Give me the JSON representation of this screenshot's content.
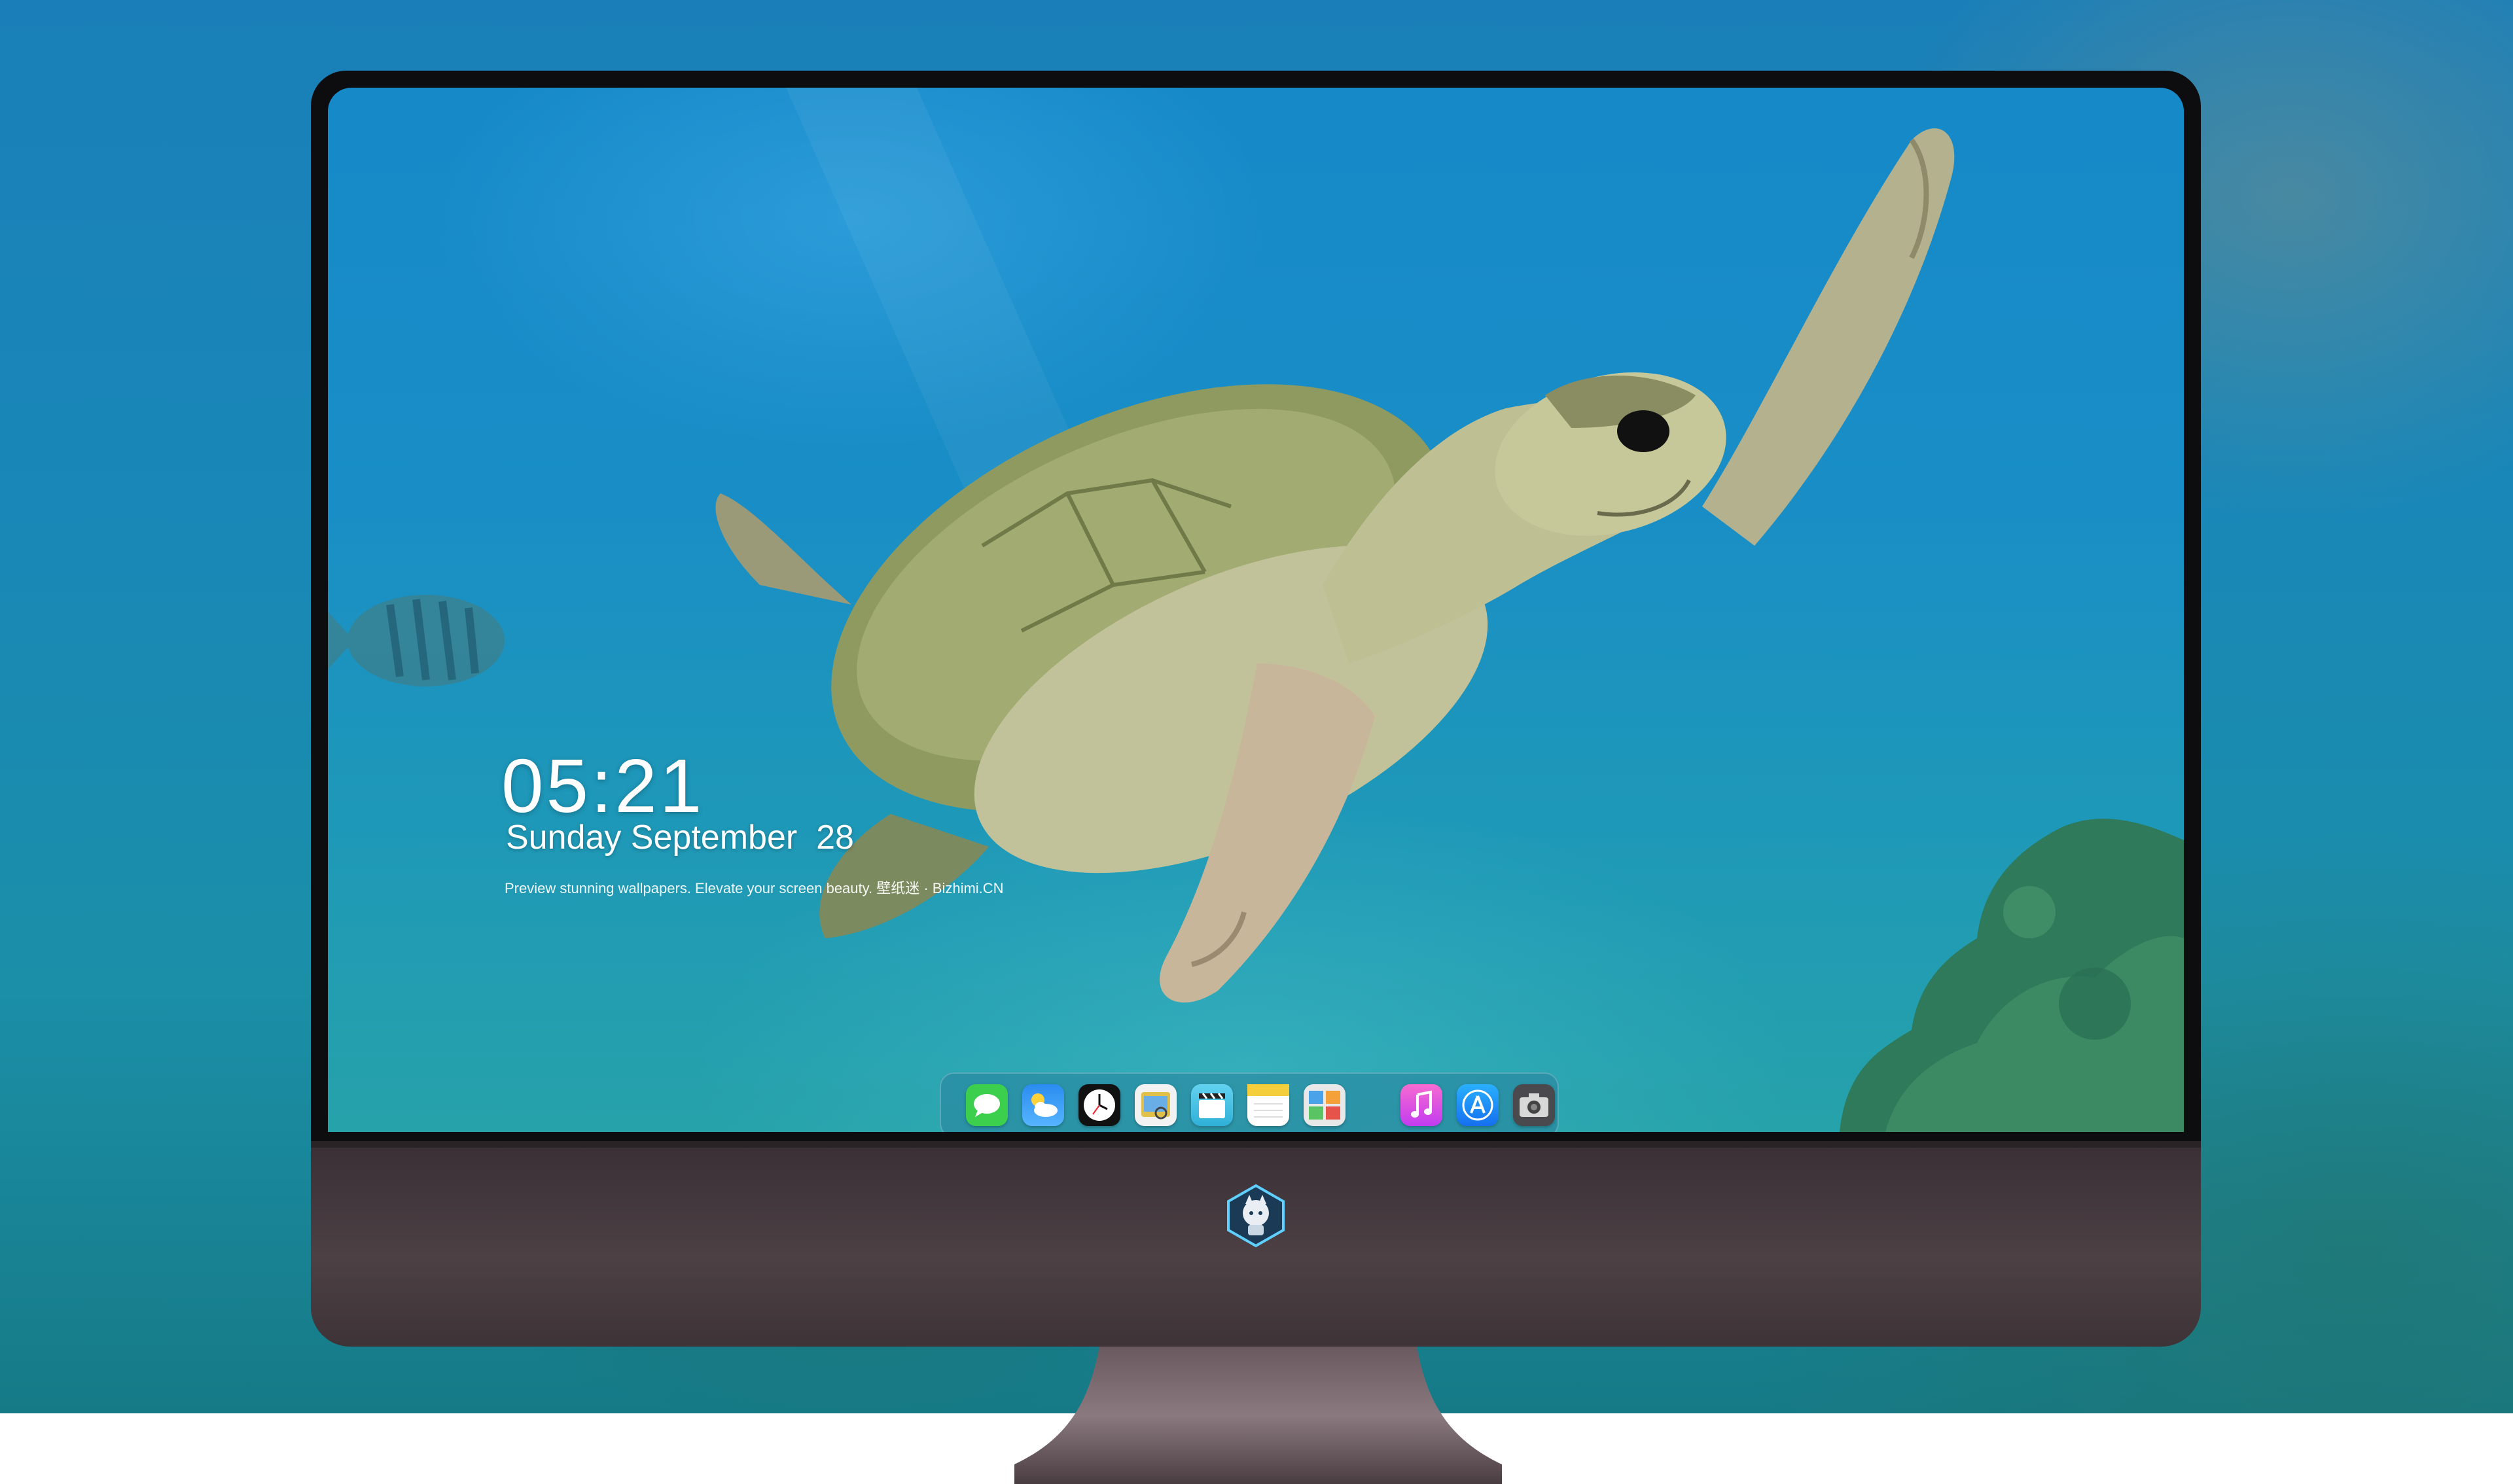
{
  "lockscreen": {
    "time": "05:21",
    "date": "Sunday September  28",
    "tagline": "Preview stunning wallpapers. Elevate your screen beauty. 壁纸迷 · Bizhimi.CN"
  },
  "dock": {
    "apps": [
      {
        "name": "Messages",
        "icon": "messages-icon"
      },
      {
        "name": "Weather",
        "icon": "weather-icon"
      },
      {
        "name": "Clock",
        "icon": "clock-icon"
      },
      {
        "name": "Preview",
        "icon": "preview-icon"
      },
      {
        "name": "Clips",
        "icon": "clips-icon"
      },
      {
        "name": "Notes",
        "icon": "notes-icon"
      },
      {
        "name": "Photo Booth",
        "icon": "photo-booth-icon"
      },
      {
        "name": "Music",
        "icon": "music-icon"
      },
      {
        "name": "App Store",
        "icon": "app-store-icon"
      },
      {
        "name": "Camera",
        "icon": "camera-icon"
      }
    ]
  },
  "colors": {
    "ocean": "#1689c9",
    "bezel": "#0d0d10",
    "chin": "#4c4044",
    "turtle_shell": "#8e9a60"
  }
}
